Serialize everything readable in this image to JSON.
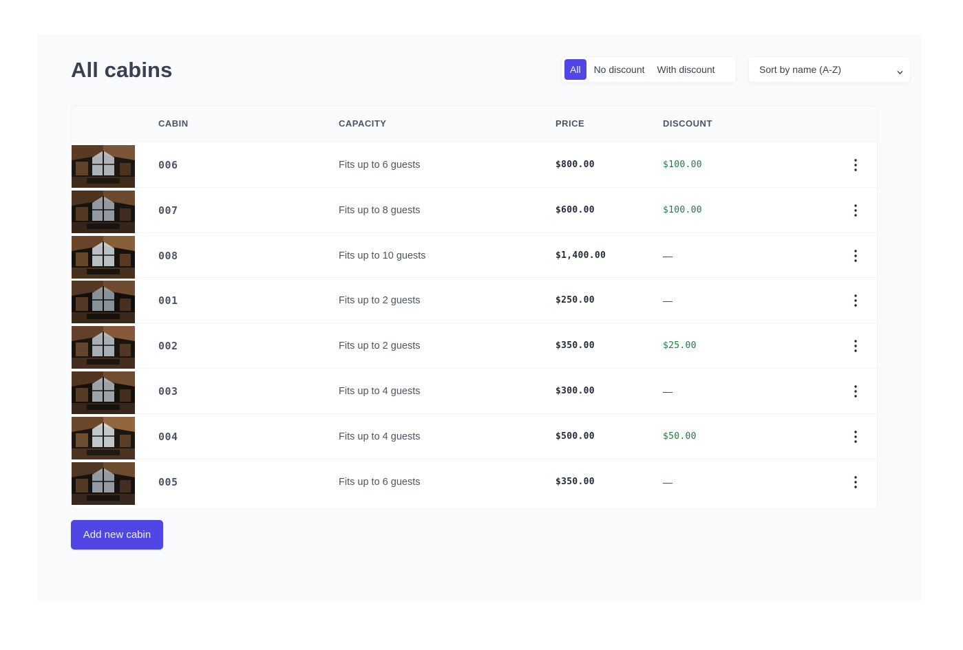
{
  "page": {
    "title": "All cabins"
  },
  "filter": {
    "options": [
      "All",
      "No discount",
      "With discount"
    ],
    "active": "All"
  },
  "sort": {
    "selected": "Sort by name (A-Z)"
  },
  "table": {
    "columns": [
      "CABIN",
      "CAPACITY",
      "PRICE",
      "DISCOUNT"
    ],
    "rows": [
      {
        "name": "006",
        "capacity": "Fits up to 6 guests",
        "price": "$800.00",
        "discount": "$100.00"
      },
      {
        "name": "007",
        "capacity": "Fits up to 8 guests",
        "price": "$600.00",
        "discount": "$100.00"
      },
      {
        "name": "008",
        "capacity": "Fits up to 10 guests",
        "price": "$1,400.00",
        "discount": "—"
      },
      {
        "name": "001",
        "capacity": "Fits up to 2 guests",
        "price": "$250.00",
        "discount": "—"
      },
      {
        "name": "002",
        "capacity": "Fits up to 2 guests",
        "price": "$350.00",
        "discount": "$25.00"
      },
      {
        "name": "003",
        "capacity": "Fits up to 4 guests",
        "price": "$300.00",
        "discount": "—"
      },
      {
        "name": "004",
        "capacity": "Fits up to 4 guests",
        "price": "$500.00",
        "discount": "$50.00"
      },
      {
        "name": "005",
        "capacity": "Fits up to 6 guests",
        "price": "$350.00",
        "discount": "—"
      }
    ]
  },
  "actions": {
    "add_label": "Add new cabin"
  },
  "icons": {
    "sort": "chevron-down-icon",
    "row_menu": "vertical-dots-icon",
    "thumbnail": "cabin-photo"
  },
  "colors": {
    "brand": "#4f46e5",
    "discount": "#15803d",
    "background": "#f9fafb"
  }
}
